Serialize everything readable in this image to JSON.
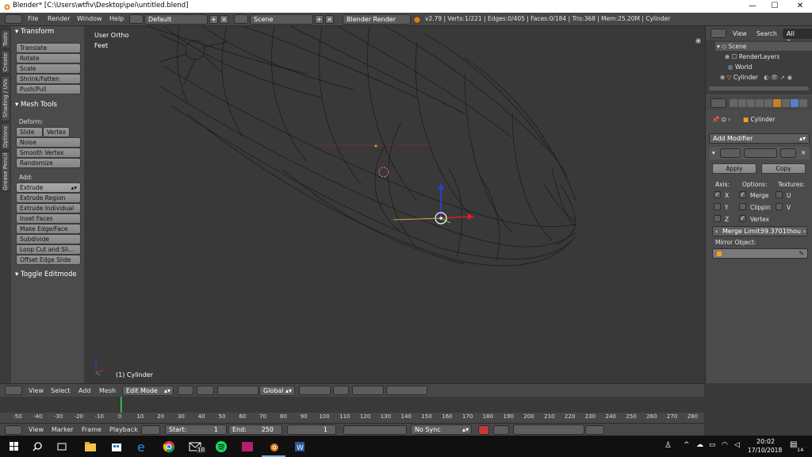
{
  "titlebar": {
    "title": "Blender* [C:\\Users\\wtfiv\\Desktop\\pei\\untitled.blend]",
    "minimize": "—",
    "maximize": "☐",
    "close": "✕"
  },
  "menubar": {
    "menus": [
      "File",
      "Render",
      "Window",
      "Help"
    ],
    "layout_value": "Default",
    "scene_value": "Scene",
    "engine_value": "Blender Render",
    "stats": "v2.79 | Verts:1/221 | Edges:0/405 | Faces:0/184 | Tris:368 | Mem:25.20M | Cylinder"
  },
  "vtabs": [
    "Tools",
    "Create",
    "Shading / UVs",
    "Options",
    "Grease Pencil"
  ],
  "toolshelf": {
    "transform_header": "Transform",
    "transform_buttons": [
      "Translate",
      "Rotate",
      "Scale",
      "Shrink/Fatten",
      "Push/Pull"
    ],
    "mesh_tools_header": "Mesh Tools",
    "deform_label": "Deform:",
    "slide_edge": "Slide Ed",
    "vertex": "Vertex",
    "deform_buttons": [
      "Noise",
      "Smooth Vertex",
      "Randomize"
    ],
    "add_label": "Add:",
    "extrude": "Extrude",
    "add_buttons": [
      "Extrude Region",
      "Extrude Individual",
      "Inset Faces",
      "Make Edge/Face",
      "Subdivide",
      "Loop Cut and Sli...",
      "Offset Edge Slide"
    ],
    "toggle_editmode": "Toggle Editmode"
  },
  "viewport": {
    "view_name": "User Ortho",
    "units": "Feet",
    "object_label": "(1) Cylinder"
  },
  "outliner": {
    "view": "View",
    "search": "Search",
    "all_scenes": "All Scenes",
    "items": [
      "Scene",
      "RenderLayers",
      "World",
      "Cylinder"
    ]
  },
  "properties": {
    "object_name": "Cylinder",
    "add_modifier": "Add Modifier",
    "apply": "Apply",
    "copy": "Copy",
    "axis_label": "Axis:",
    "options_label": "Options:",
    "textures_label": "Textures:",
    "axis_items": [
      "X",
      "Y",
      "Z"
    ],
    "option_items": [
      "Merge",
      "Clippin",
      "Vertex"
    ],
    "texture_items": [
      "U",
      "V"
    ],
    "merge_limit_label": "Merge Limit:",
    "merge_limit_value": "39.3701thou",
    "mirror_object_label": "Mirror Object:"
  },
  "vp_header": {
    "view": "View",
    "select": "Select",
    "add": "Add",
    "mesh": "Mesh",
    "mode": "Edit Mode",
    "orientation": "Global"
  },
  "timeline": {
    "ticks": [
      "-50",
      "-40",
      "-30",
      "-20",
      "-10",
      "0",
      "10",
      "20",
      "30",
      "40",
      "50",
      "60",
      "70",
      "80",
      "90",
      "100",
      "110",
      "120",
      "130",
      "140",
      "150",
      "160",
      "170",
      "180",
      "190",
      "200",
      "210",
      "220",
      "230",
      "240",
      "250",
      "260",
      "270",
      "280"
    ]
  },
  "tl_header": {
    "view": "View",
    "marker": "Marker",
    "frame": "Frame",
    "playback": "Playback",
    "start_label": "Start:",
    "start_value": "1",
    "end_label": "End:",
    "end_value": "250",
    "current": "1",
    "sync": "No Sync"
  },
  "taskbar": {
    "time": "20:02",
    "date": "17/10/2018",
    "notif": "14",
    "mail_badge": "10"
  },
  "colors": {
    "panel": "#4b4b4b",
    "viewport": "#393939",
    "accent": "#5680c2",
    "taskbar": "#101010"
  }
}
